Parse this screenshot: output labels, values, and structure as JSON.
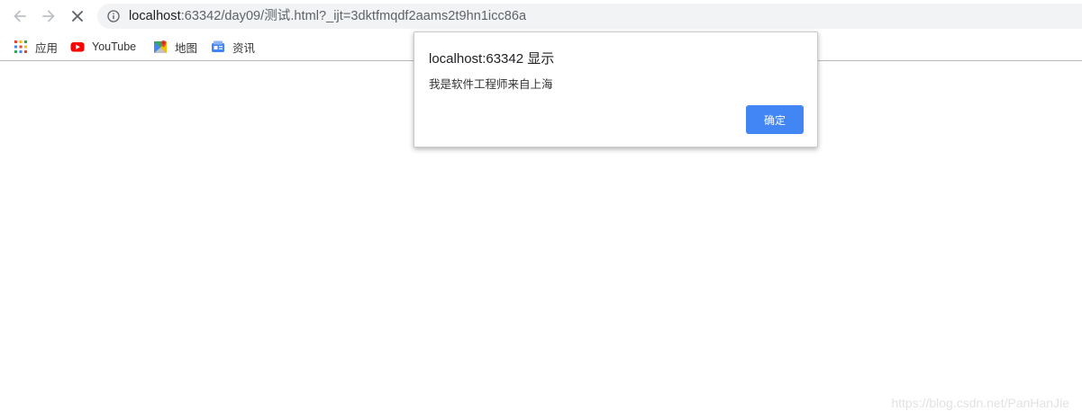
{
  "toolbar": {
    "back_icon": "arrow-back-icon",
    "forward_icon": "arrow-forward-icon",
    "stop_icon": "close-icon",
    "address": {
      "security_icon": "info-icon",
      "host": "localhost",
      "path": ":63342/day09/测试.html?_ijt=3dktfmqdf2aams2t9hn1icc86a"
    }
  },
  "bookmarks": [
    {
      "icon": "apps-grid-icon",
      "label": "应用"
    },
    {
      "icon": "youtube-icon",
      "label": "YouTube"
    },
    {
      "icon": "maps-icon",
      "label": "地图"
    },
    {
      "icon": "news-icon",
      "label": "资讯"
    }
  ],
  "dialog": {
    "title": "localhost:63342 显示",
    "message": "我是软件工程师来自上海",
    "ok_label": "确定",
    "ok_color": "#4285f4"
  },
  "watermark": "https://blog.csdn.net/PanHanJie"
}
